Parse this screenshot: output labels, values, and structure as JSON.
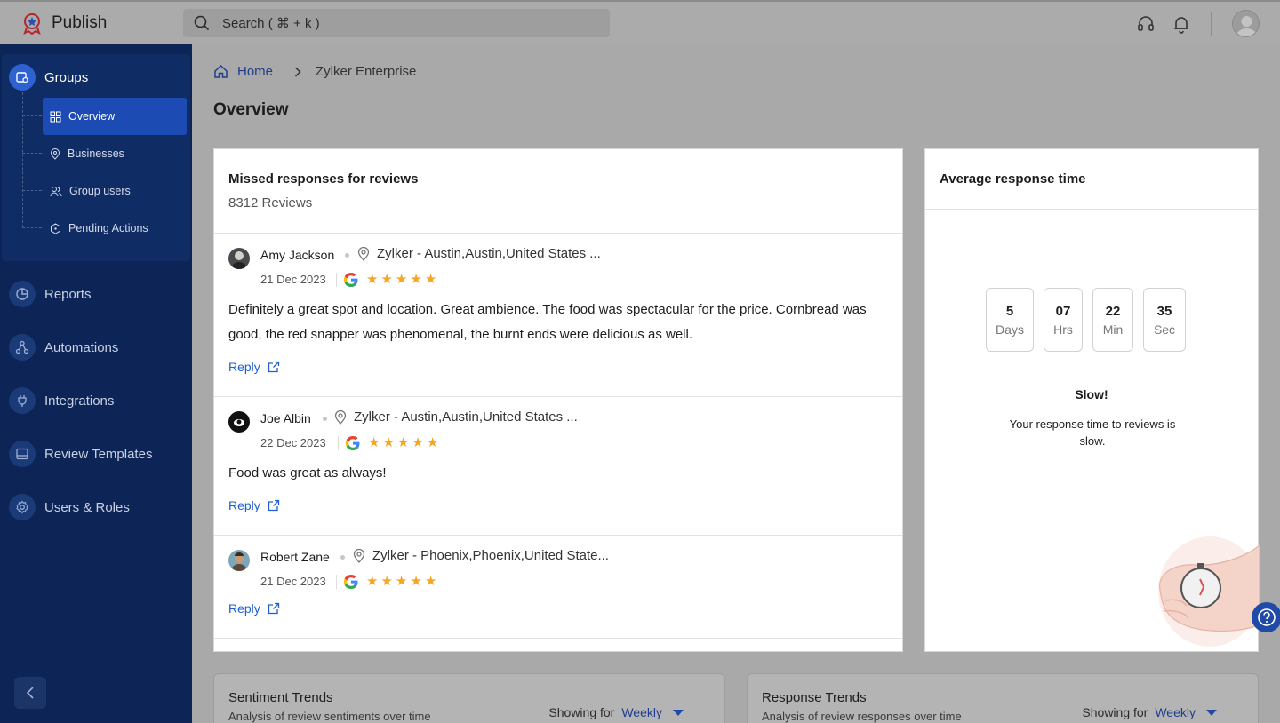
{
  "app": {
    "name": "Publish"
  },
  "search": {
    "placeholder": "Search ( ⌘ + k )"
  },
  "sidebar": {
    "groups_label": "Groups",
    "sub_items": [
      {
        "label": "Overview",
        "icon": "dashboard-icon"
      },
      {
        "label": "Businesses",
        "icon": "location-pin-icon"
      },
      {
        "label": "Group users",
        "icon": "users-icon"
      },
      {
        "label": "Pending Actions",
        "icon": "hexagon-icon"
      }
    ],
    "items": [
      {
        "label": "Reports",
        "icon": "pie-chart-icon"
      },
      {
        "label": "Automations",
        "icon": "workflow-icon"
      },
      {
        "label": "Integrations",
        "icon": "plug-icon"
      },
      {
        "label": "Review Templates",
        "icon": "template-icon"
      },
      {
        "label": "Users & Roles",
        "icon": "gear-icon"
      }
    ]
  },
  "breadcrumb": {
    "home": "Home",
    "current": "Zylker Enterprise"
  },
  "page": {
    "title": "Overview"
  },
  "missed": {
    "title": "Missed responses for reviews",
    "count": "8312 Reviews",
    "reply_label": "Reply",
    "reviews": [
      {
        "name": "Amy Jackson",
        "location": "Zylker - Austin,Austin,United States ...",
        "date": "21 Dec 2023",
        "rating": 5,
        "text": "Definitely a great spot and location. Great ambience. The food was spectacular for the price. Cornbread was good, the red snapper was phenomenal, the burnt ends were delicious as well."
      },
      {
        "name": "Joe Albin",
        "location": "Zylker - Austin,Austin,United States ...",
        "date": "22 Dec 2023",
        "rating": 5,
        "text": "Food was great as always!"
      },
      {
        "name": "Robert Zane",
        "location": "Zylker - Phoenix,Phoenix,United State...",
        "date": "21 Dec 2023",
        "rating": 5,
        "text": ""
      }
    ]
  },
  "average": {
    "title": "Average response time",
    "timers": [
      {
        "value": "5",
        "unit": "Days"
      },
      {
        "value": "07",
        "unit": "Hrs"
      },
      {
        "value": "22",
        "unit": "Min"
      },
      {
        "value": "35",
        "unit": "Sec"
      }
    ],
    "status_title": "Slow!",
    "status_text": "Your response time to reviews is slow."
  },
  "sentiment": {
    "title": "Sentiment Trends",
    "subtitle": "Analysis of review sentiments over time",
    "showing_label": "Showing for",
    "period": "Weekly"
  },
  "response_trends": {
    "title": "Response Trends",
    "subtitle": "Analysis of review responses over time",
    "showing_label": "Showing for",
    "period": "Weekly"
  },
  "colors": {
    "sidebar": "#0d2556",
    "accent": "#1c4bb3",
    "star": "#f5a623",
    "link": "#1f5fcf"
  }
}
